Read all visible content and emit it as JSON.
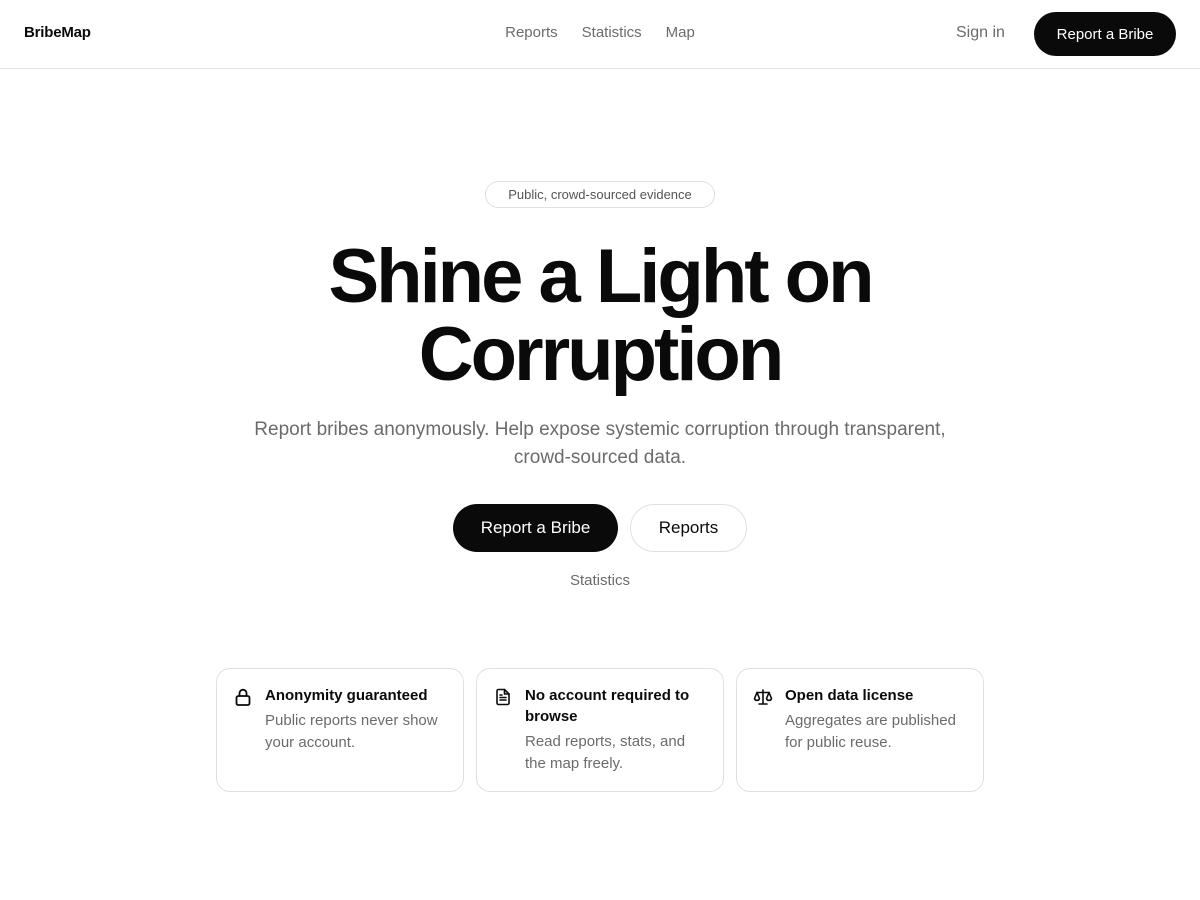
{
  "header": {
    "brand": "BribeMap",
    "nav": [
      {
        "label": "Reports"
      },
      {
        "label": "Statistics"
      },
      {
        "label": "Map"
      }
    ],
    "sign_in": "Sign in",
    "cta": "Report a Bribe"
  },
  "hero": {
    "badge": "Public, crowd-sourced evidence",
    "title_line1": "Shine a Light on",
    "title_line2": "Corruption",
    "subtitle": "Report bribes anonymously. Help expose systemic corruption through transparent, crowd-sourced data.",
    "primary_button": "Report a Bribe",
    "secondary_button": "Reports",
    "tertiary_link": "Statistics"
  },
  "features": [
    {
      "icon": "lock-icon",
      "title": "Anonymity guaranteed",
      "description": "Public reports never show your account."
    },
    {
      "icon": "document-icon",
      "title": "No account required to browse",
      "description": "Read reports, stats, and the map freely."
    },
    {
      "icon": "scale-icon",
      "title": "Open data license",
      "description": "Aggregates are published for public reuse."
    }
  ],
  "colors": {
    "primary": "#0a0a0a",
    "muted_text": "#6b6b6b",
    "border": "#e0e0e0",
    "background": "#ffffff"
  }
}
